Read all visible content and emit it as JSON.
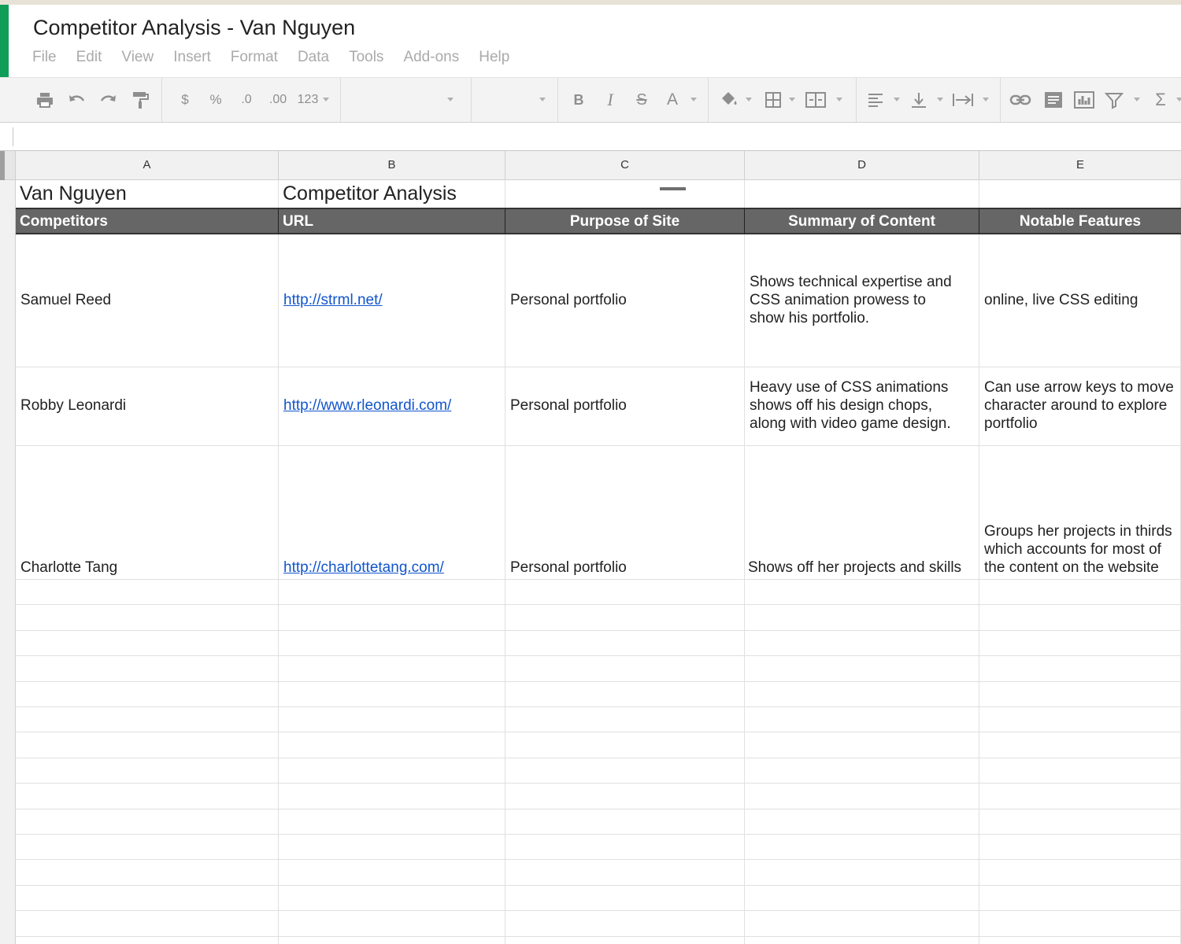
{
  "app": {
    "title": "Competitor Analysis - Van Nguyen",
    "menu": [
      "File",
      "Edit",
      "View",
      "Insert",
      "Format",
      "Data",
      "Tools",
      "Add-ons",
      "Help"
    ],
    "accent_color": "#0f9d58"
  },
  "toolbar": {
    "currency": "$",
    "percent": "%",
    "decrease_decimal": ".0",
    "increase_decimal": ".00",
    "more_formats": "123",
    "bold": "B",
    "italic": "I",
    "strike": "S",
    "text_color": "A",
    "sum": "Σ",
    "icons": [
      "print-icon",
      "undo-icon",
      "redo-icon",
      "paint-format-icon",
      "fill-color-icon",
      "borders-icon",
      "merge-cells-icon",
      "align-left-icon",
      "valign-bottom-icon",
      "text-wrap-icon",
      "link-icon",
      "comment-icon",
      "chart-icon",
      "filter-icon",
      "functions-icon"
    ]
  },
  "sheet": {
    "columns": [
      "A",
      "B",
      "C",
      "D",
      "E"
    ],
    "title_row": {
      "a": "Van Nguyen",
      "b": "Competitor Analysis"
    },
    "header_row": [
      "Competitors",
      "URL",
      "Purpose of Site",
      "Summary of Content",
      "Notable Features"
    ],
    "header_color": "#666666",
    "link_color": "#1155cc",
    "rows": [
      {
        "competitor": "Samuel Reed",
        "url": "http://strml.net/",
        "purpose": "Personal portfolio",
        "summary": [
          "Shows technical expertise and",
          "CSS animation prowess to",
          "show his portfolio."
        ],
        "features": [
          "online, live CSS editing"
        ]
      },
      {
        "competitor": "Robby Leonardi",
        "url": "http://www.rleonardi.com/",
        "purpose": "Personal portfolio",
        "summary": [
          "Heavy use of CSS animations",
          "shows off his design chops,",
          "along with video game design."
        ],
        "features": [
          "Can use arrow keys to move",
          "character around to explore",
          "portfolio"
        ]
      },
      {
        "competitor": "Charlotte Tang",
        "url": "http://charlottetang.com/",
        "purpose": "Personal portfolio",
        "summary": [
          "Shows off her projects and skills"
        ],
        "features": [
          "Groups her projects in thirds",
          "which accounts for most of",
          "the content on the website"
        ]
      }
    ]
  }
}
